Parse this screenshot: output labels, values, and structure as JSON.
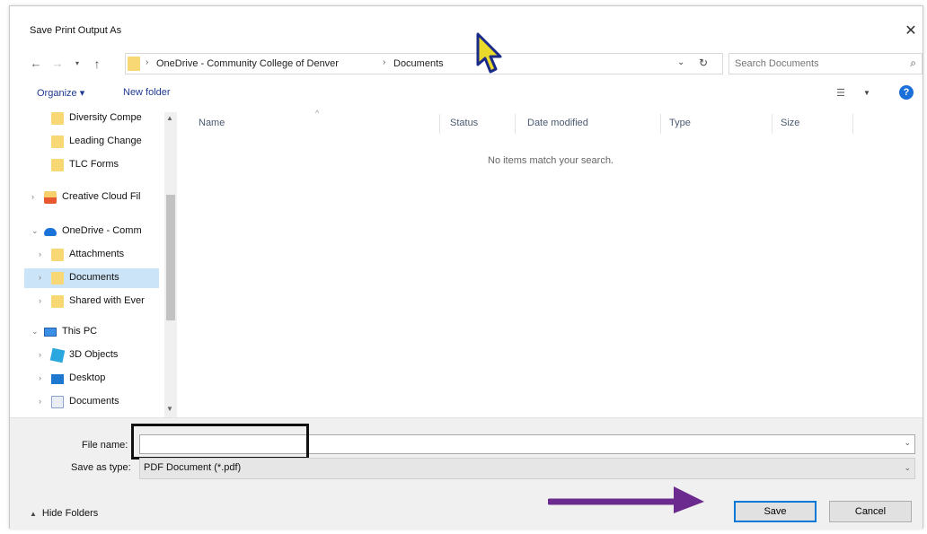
{
  "window": {
    "title": "Save Print Output As",
    "close_glyph": "✕"
  },
  "navigation": {
    "back_glyph": "←",
    "forward_glyph": "→",
    "recent_glyph": "▾",
    "up_glyph": "↑",
    "breadcrumb": [
      "OneDrive - Community College of Denver",
      "Documents"
    ],
    "refresh_glyph": "↻",
    "dropdown_glyph": "⌄",
    "search_placeholder": "Search Documents"
  },
  "toolbar": {
    "organize_label": "Organize ▾",
    "new_folder_label": "New folder"
  },
  "nav_tree": [
    {
      "label": "Diversity Compe",
      "icon": "folder-icon",
      "caret": ""
    },
    {
      "label": "Leading Change",
      "icon": "folder-icon",
      "caret": ""
    },
    {
      "label": "TLC Forms",
      "icon": "folder-icon",
      "caret": ""
    },
    {
      "label": "Creative Cloud Fil",
      "icon": "creative-cloud-icon",
      "caret": "›"
    },
    {
      "label": "OneDrive - Comm",
      "icon": "onedrive-icon",
      "caret": "⌄"
    },
    {
      "label": "Attachments",
      "icon": "folder-icon",
      "caret": "›"
    },
    {
      "label": "Documents",
      "icon": "folder-icon",
      "caret": "›",
      "selected": true
    },
    {
      "label": "Shared with Ever",
      "icon": "folder-icon",
      "caret": "›"
    },
    {
      "label": "This PC",
      "icon": "pc-icon",
      "caret": "⌄"
    },
    {
      "label": "3D Objects",
      "icon": "3d-objects-icon",
      "caret": "›"
    },
    {
      "label": "Desktop",
      "icon": "desktop-icon",
      "caret": "›"
    },
    {
      "label": "Documents",
      "icon": "documents-icon",
      "caret": "›"
    }
  ],
  "columns": [
    "Name",
    "Status",
    "Date modified",
    "Type",
    "Size"
  ],
  "empty_message": "No items match your search.",
  "form": {
    "file_name_label": "File name:",
    "file_name_value": "",
    "save_as_type_label": "Save as type:",
    "save_as_type_value": "PDF Document (*.pdf)"
  },
  "footer": {
    "hide_folders_label": "Hide Folders",
    "save_label": "Save",
    "cancel_label": "Cancel"
  },
  "colors": {
    "annotation_arrow": "#6b2a8e",
    "accent": "#0078d7",
    "selection": "#cce4f7"
  }
}
